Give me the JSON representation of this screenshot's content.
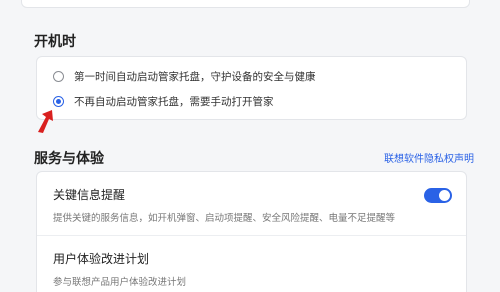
{
  "startup": {
    "section_title": "开机时",
    "options": [
      {
        "label": "第一时间自动启动管家托盘，守护设备的安全与健康",
        "checked": false
      },
      {
        "label": "不再自动启动管家托盘，需要手动打开管家",
        "checked": true
      }
    ]
  },
  "service": {
    "section_title": "服务与体验",
    "privacy_link": "联想软件隐私权声明",
    "items": [
      {
        "title": "关键信息提醒",
        "desc": "提供关键的服务信息，如开机弹窗、启动项提醒、安全风险提醒、电量不足提醒等",
        "toggle_on": true
      },
      {
        "title": "用户体验改进计划",
        "desc": "参与联想产品用户体验改进计划"
      }
    ]
  },
  "colors": {
    "accent": "#2a62e6",
    "annotation": "#d9201f"
  }
}
